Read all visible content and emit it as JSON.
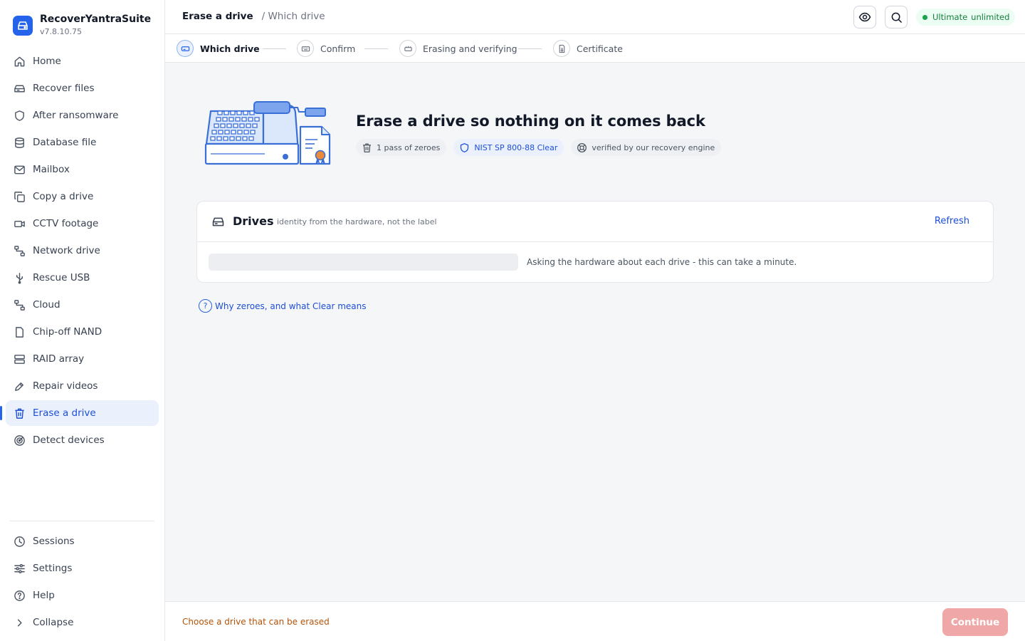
{
  "app": {
    "name": "RecoverYantraSuite",
    "version": "v7.8.10.75"
  },
  "sidebar": {
    "items": [
      {
        "label": "Home",
        "icon": "home-icon"
      },
      {
        "label": "Recover files",
        "icon": "drive-icon"
      },
      {
        "label": "After ransomware",
        "icon": "shield-icon"
      },
      {
        "label": "Database file",
        "icon": "database-icon"
      },
      {
        "label": "Mailbox",
        "icon": "mail-icon"
      },
      {
        "label": "Copy a drive",
        "icon": "copy-icon"
      },
      {
        "label": "CCTV footage",
        "icon": "camera-icon"
      },
      {
        "label": "Network drive",
        "icon": "network-icon"
      },
      {
        "label": "Rescue USB",
        "icon": "usb-icon"
      },
      {
        "label": "Cloud",
        "icon": "cloud-network-icon"
      },
      {
        "label": "Chip-off NAND",
        "icon": "chip-icon"
      },
      {
        "label": "RAID array",
        "icon": "raid-icon"
      },
      {
        "label": "Repair videos",
        "icon": "pen-icon"
      },
      {
        "label": "Erase a drive",
        "icon": "trash-icon",
        "active": true
      },
      {
        "label": "Detect devices",
        "icon": "radar-icon"
      }
    ],
    "bottom_items": [
      {
        "label": "Sessions",
        "icon": "clock-icon"
      },
      {
        "label": "Settings",
        "icon": "sliders-icon"
      },
      {
        "label": "Help",
        "icon": "help-icon"
      },
      {
        "label": "Collapse",
        "icon": "chevron-right-icon"
      }
    ]
  },
  "header": {
    "title": "Erase a drive",
    "crumb": "/ Which drive",
    "plan_status": "Ultimate",
    "plan_value": "unlimited",
    "plan_color": "#16a34a"
  },
  "stepper": {
    "steps": [
      {
        "label": "Which drive",
        "state": "current"
      },
      {
        "label": "Confirm",
        "state": "pending"
      },
      {
        "label": "Erasing and verifying",
        "state": "pending"
      },
      {
        "label": "Certificate",
        "state": "pending"
      }
    ]
  },
  "hero": {
    "title": "Erase a drive so nothing on it comes back",
    "chips": [
      {
        "label": "1 pass of zeroes",
        "icon": "trash-icon"
      },
      {
        "label": "NIST SP 800-88 Clear",
        "icon": "shield-icon"
      },
      {
        "label": "verified by our recovery engine",
        "icon": "target-icon"
      }
    ]
  },
  "drives": {
    "title": "Drives",
    "subtitle": "identity from the hardware, not the label",
    "refresh_label": "Refresh",
    "loading_text": "Asking the hardware about each drive - this can take a minute."
  },
  "help_link": "Why zeroes, and what Clear means",
  "footer": {
    "hint": "Choose a drive that can be erased",
    "continue_label": "Continue",
    "accent": "#2563eb",
    "warning_color": "#b45309"
  }
}
